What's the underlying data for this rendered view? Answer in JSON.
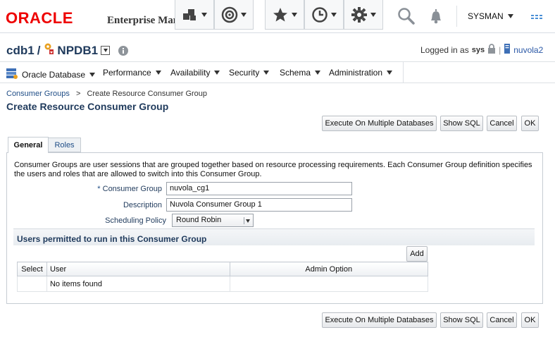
{
  "header": {
    "logo": "ORACLE",
    "product": "Enterprise Manager Cloud Control",
    "user": "SYSMAN",
    "toolbar_icons": [
      "targets-icon",
      "target-icon",
      "favorites-icon",
      "history-icon",
      "setup-icon",
      "search-icon",
      "notifications-icon",
      "more-icon"
    ]
  },
  "target": {
    "cdb": "cdb1",
    "separator": "/",
    "pdb": "NPDB1",
    "logged_in_label": "Logged in as",
    "logged_in_user": "sys",
    "host": "nuvola2"
  },
  "nav": {
    "items": [
      "Oracle Database",
      "Performance",
      "Availability",
      "Security",
      "Schema",
      "Administration"
    ]
  },
  "breadcrumb": {
    "parent": "Consumer Groups",
    "separator": ">",
    "current": "Create Resource Consumer Group"
  },
  "page": {
    "title": "Create Resource Consumer Group"
  },
  "actions": {
    "execute_multi": "Execute On Multiple Databases",
    "show_sql": "Show SQL",
    "cancel": "Cancel",
    "ok": "OK"
  },
  "tabs": [
    "General",
    "Roles"
  ],
  "form": {
    "description_text": "Consumer Groups are user sessions that are grouped together based on resource processing requirements. Each Consumer Group definition specifies the users and roles that are allowed to switch into this Consumer Group.",
    "required_marker": "*",
    "consumer_group_label": "Consumer Group",
    "consumer_group_value": "nuvola_cg1",
    "description_label": "Description",
    "description_value": "Nuvola Consumer Group 1",
    "scheduling_label": "Scheduling Policy",
    "scheduling_value": "Round Robin"
  },
  "users_section": {
    "title": "Users permitted to run in this Consumer Group",
    "add_label": "Add",
    "columns": [
      "Select",
      "User",
      "Admin Option"
    ],
    "empty_text": "No items found"
  },
  "colors": {
    "brand_red": "#e00000",
    "heading_blue": "#1f3a5c",
    "link_blue": "#1f4d86"
  }
}
